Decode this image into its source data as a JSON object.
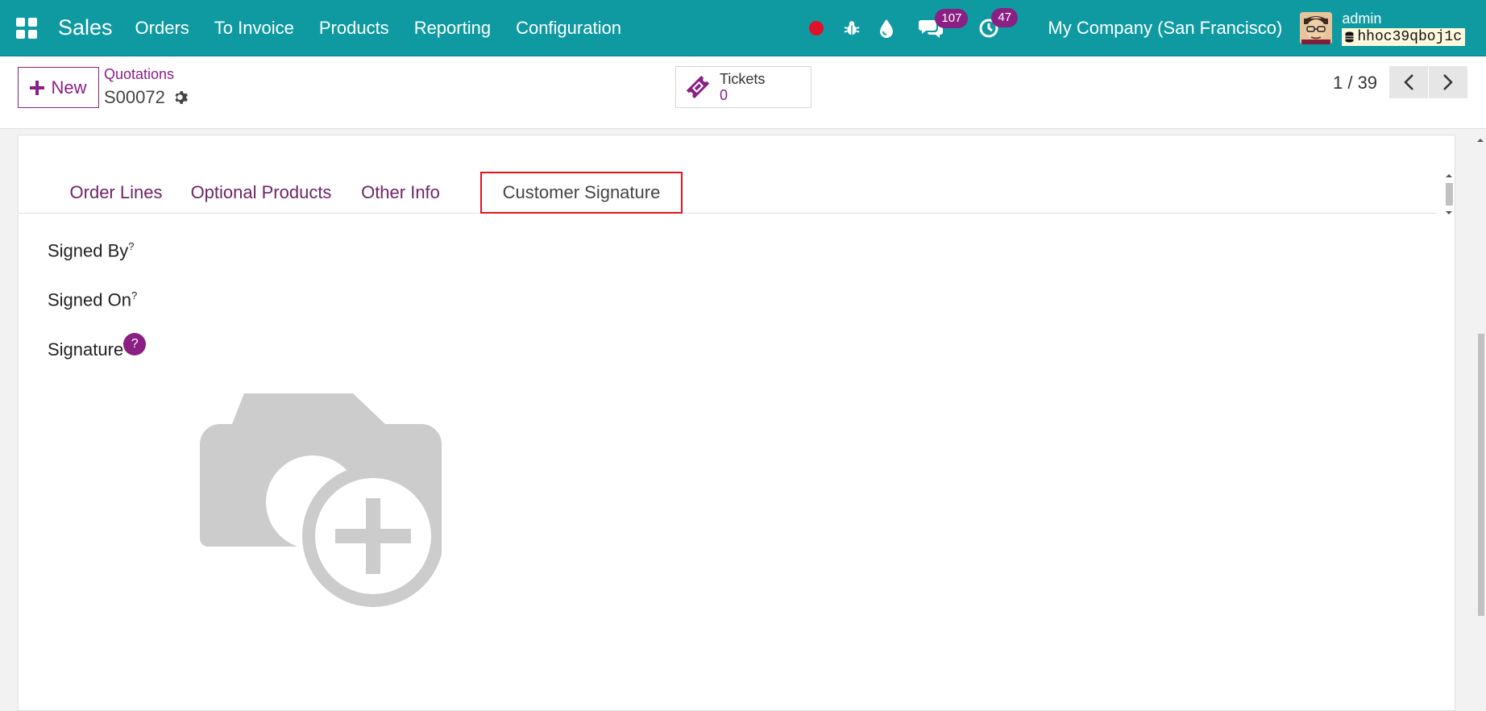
{
  "navbar": {
    "app_name": "Sales",
    "menu": [
      "Orders",
      "To Invoice",
      "Products",
      "Reporting",
      "Configuration"
    ],
    "messages_count": "107",
    "activities_count": "47",
    "company": "My Company (San Francisco)",
    "user": "admin",
    "database": "hhoc39qboj1c",
    "icons": [
      "apps-grid-icon",
      "recording-icon",
      "bug-icon",
      "drop-icon",
      "chat-icon",
      "clock-icon"
    ]
  },
  "control": {
    "new_label": "New",
    "breadcrumb_parent": "Quotations",
    "record_name": "S00072",
    "smart_button": {
      "label": "Tickets",
      "value": "0"
    },
    "pager": "1 / 39"
  },
  "tabs": [
    {
      "label": "Order Lines",
      "active": false
    },
    {
      "label": "Optional Products",
      "active": false
    },
    {
      "label": "Other Info",
      "active": false
    },
    {
      "label": "Customer Signature",
      "active": true
    }
  ],
  "fields": {
    "signed_by": {
      "label": "Signed By",
      "help": "?"
    },
    "signed_on": {
      "label": "Signed On",
      "help": "?"
    },
    "signature": {
      "label": "Signature",
      "help": "?"
    }
  },
  "colors": {
    "navbar": "#0f9aa2",
    "accent": "#8a1f84",
    "highlight_border": "#e0141f"
  }
}
